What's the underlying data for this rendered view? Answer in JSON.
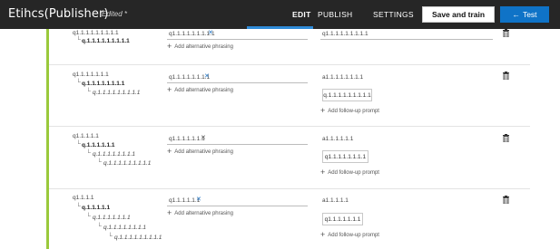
{
  "header": {
    "title": "Etihcs(Publisher)",
    "edited": "Edited *",
    "tabs": {
      "edit": "EDIT",
      "publish": "PUBLISH",
      "settings": "SETTINGS"
    },
    "save_label": "Save and train",
    "test_label": "Test",
    "test_icon": "arrow-left-icon"
  },
  "common": {
    "add_phrasing": "Add alternative phrasing",
    "add_followup": "Add follow-up prompt"
  },
  "qna": [
    {
      "questions": [
        "q1.1.1.1.1.1.1.1.1",
        "q.1.1.1.1.1.1.1.1.1"
      ],
      "phrasing": "q1.1.1.1.1.1.1.1.1",
      "answer": "q1.1.1.1.1.1.1.1.1"
    },
    {
      "questions": [
        "q1.1.1.1.1.1.1",
        "q.1.1.1.1.1.1.1.1",
        "q.1.1.1.1.1.1.1.1.1"
      ],
      "phrasing": "q1.1.1.1.1.1.1.1",
      "answer": "a1.1.1.1.1.1.1.1",
      "prompt": "q.1.1.1.1.1.1.1.1.1"
    },
    {
      "questions": [
        "q1.1.1.1.1",
        "q.1.1.1.1.1.1",
        "q.1.1.1.1.1.1.1.1",
        "q.1.1.1.1.1.1.1.1.1"
      ],
      "phrasing": "q1.1.1.1.1.1.1",
      "answer": "a1.1.1.1.1.1",
      "prompt": "q1.1.1.1.1.1.1.1"
    },
    {
      "questions": [
        "q1.1.1.1",
        "q.1.1.1.1.1",
        "q.1.1.1.1.1.1.1",
        "q.1.1.1.1.1.1.1.1",
        "q.1.1.1.1.1.1.1.1.1"
      ],
      "phrasing": "q1.1.1.1.1.1",
      "answer": "a1.1.1.1.1",
      "prompt": "q1.1.1.1.1.1.1"
    }
  ]
}
